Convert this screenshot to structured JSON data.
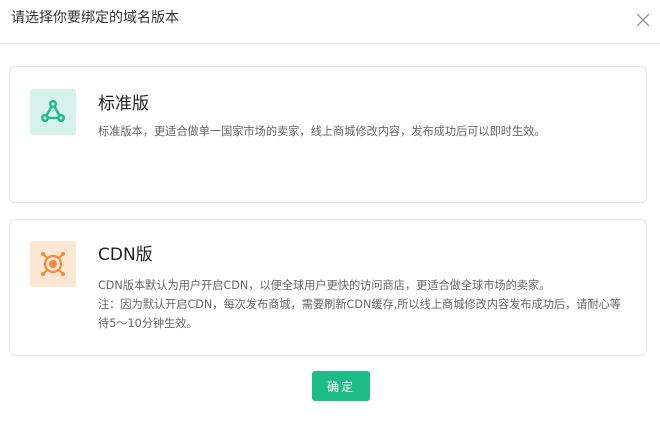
{
  "dialog": {
    "title": "请选择你要绑定的域名版本",
    "close_icon": "close-icon",
    "options": [
      {
        "title": "标准版",
        "description": "标准版本，更适合做单一国家市场的卖家，线上商城修改内容，发布成功后可以即时生效。",
        "icon": "network-nodes-icon",
        "icon_color": "#1ebd87",
        "icon_bg": "#d6f2ea"
      },
      {
        "title": "CDN版",
        "description_line1": "CDN版本默认为用户开启CDN，以便全球用户更快的访问商店，更适合做全球市场的卖家。",
        "description_line2": "注：因为默认开启CDN，每次发布商城，需要刷新CDN缓存,所以线上商城修改内容发布成功后，请耐心等待5～10分钟生效。",
        "icon": "globe-cdn-icon",
        "icon_color": "#f08a3c",
        "icon_bg": "#fde7d2"
      }
    ],
    "confirm_label": "确定",
    "accent_color": "#1ebd87"
  }
}
